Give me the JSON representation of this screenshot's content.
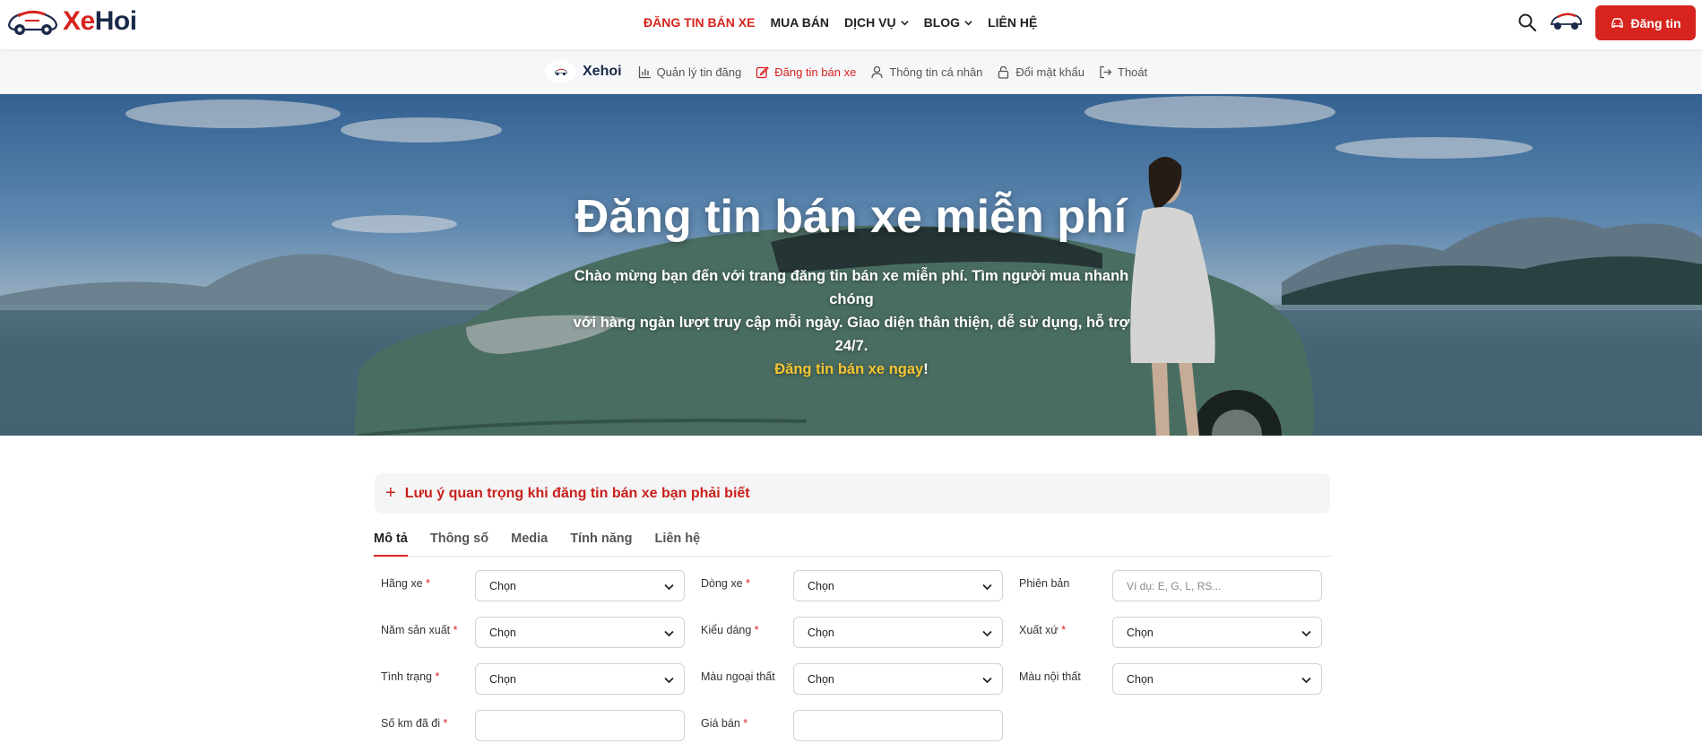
{
  "brand": {
    "logo_xe": "Xe",
    "logo_hoi": "Hoi",
    "accent": "#d7241f",
    "navy": "#1b2a4a"
  },
  "header": {
    "nav": [
      {
        "label": "ĐĂNG TIN BÁN XE",
        "active": true
      },
      {
        "label": "MUA BÁN"
      },
      {
        "label": "DỊCH VỤ",
        "dropdown": true
      },
      {
        "label": "BLOG",
        "dropdown": true
      },
      {
        "label": "LIÊN HỆ"
      }
    ],
    "icons": {
      "search": "search-icon",
      "avatar": "car-avatar-icon"
    },
    "post_button": "Đăng tin"
  },
  "subnav": {
    "brand": "Xehoi",
    "items": [
      {
        "label": "Quản lý tin đăng",
        "icon": "bar-chart-icon"
      },
      {
        "label": "Đăng tin bán xe",
        "icon": "edit-icon",
        "active": true
      },
      {
        "label": "Thông tin cá nhân",
        "icon": "user-icon"
      },
      {
        "label": "Đổi mật khẩu",
        "icon": "lock-icon"
      },
      {
        "label": "Thoát",
        "icon": "logout-icon"
      }
    ]
  },
  "hero": {
    "title": "Đăng tin bán xe miễn phí",
    "desc_line1": "Chào mừng bạn đến với trang đăng tin bán xe miễn phí. Tìm người mua nhanh chóng",
    "desc_line2": "với hàng ngàn lượt truy cập mỗi ngày. Giao diện thân thiện, dễ sử dụng, hỗ trợ 24/7.",
    "cta": "Đăng tin bán xe ngay",
    "cta_suffix": "!"
  },
  "notice": {
    "icon": "+",
    "text": "Lưu ý quan trọng khi đăng tin bán xe bạn phải biết"
  },
  "tabs": [
    {
      "label": "Mô tả",
      "active": true
    },
    {
      "label": "Thông số"
    },
    {
      "label": "Media"
    },
    {
      "label": "Tính năng"
    },
    {
      "label": "Liên hệ"
    }
  ],
  "form": {
    "required_mark": "*",
    "row1": {
      "hang_xe": {
        "label": "Hãng xe",
        "value": "Chọn"
      },
      "dong_xe": {
        "label": "Dòng xe",
        "value": "Chọn"
      },
      "phien_ban": {
        "label": "Phiên bản",
        "placeholder": "Ví dụ: E, G, L, RS..."
      }
    },
    "row2": {
      "nam_san_xuat": {
        "label": "Năm sản xuất",
        "value": "Chọn"
      },
      "kieu_dang": {
        "label": "Kiểu dáng",
        "value": "Chọn"
      },
      "xuat_xu": {
        "label": "Xuất xứ",
        "value": "Chọn"
      }
    },
    "row3": {
      "tinh_trang": {
        "label": "Tình trạng",
        "value": "Chọn"
      },
      "mau_ngoai_that": {
        "label": "Màu ngoại thất",
        "value": "Chọn"
      },
      "mau_noi_that": {
        "label": "Màu nội thất",
        "value": "Chọn"
      }
    },
    "row4": {
      "so_km": {
        "label": "Số km đã đi",
        "value": ""
      },
      "gia_ban": {
        "label": "Giá bán",
        "value": ""
      }
    }
  }
}
